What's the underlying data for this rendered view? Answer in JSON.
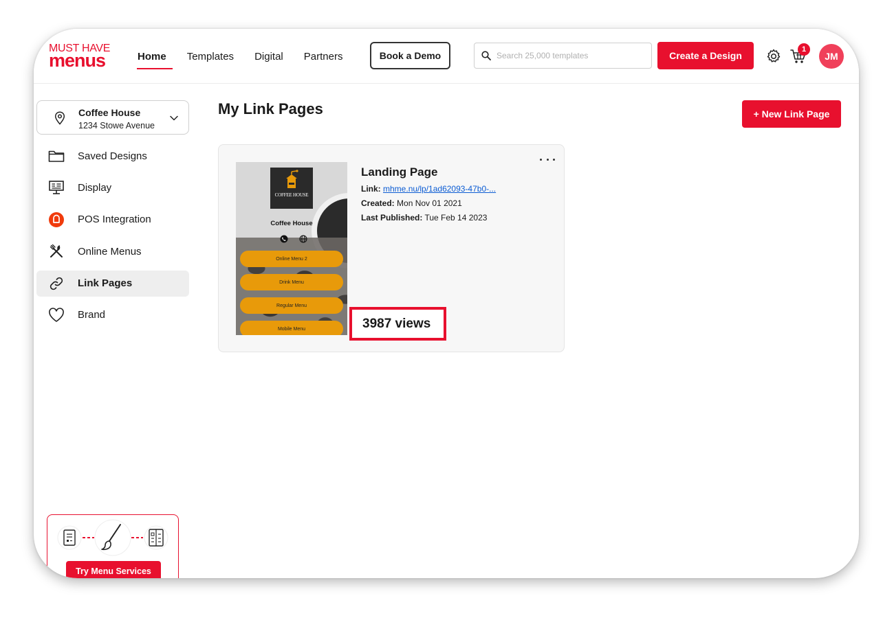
{
  "brand": {
    "logo_top": "MUST HAVE",
    "logo_bottom": "menus",
    "accent": "#e8102e"
  },
  "header": {
    "nav": [
      "Home",
      "Templates",
      "Digital",
      "Partners"
    ],
    "book_demo": "Book a Demo",
    "search_placeholder": "Search 25,000 templates",
    "create_label": "Create a Design",
    "cart_count": "1",
    "avatar_initials": "JM",
    "icons": [
      "search-icon",
      "gear-icon",
      "cart-icon"
    ]
  },
  "sidebar": {
    "location": {
      "name": "Coffee House",
      "address": "1234 Stowe Avenue"
    },
    "items": [
      {
        "label": "Saved Designs",
        "icon": "folder-icon"
      },
      {
        "label": "Display",
        "icon": "display-icon"
      },
      {
        "label": "POS Integration",
        "icon": "pos-icon"
      },
      {
        "label": "Online Menus",
        "icon": "utensils-icon"
      },
      {
        "label": "Link Pages",
        "icon": "link-icon"
      },
      {
        "label": "Brand",
        "icon": "heart-icon"
      }
    ],
    "active_item": "Link Pages",
    "promo_button": "Try Menu Services"
  },
  "main": {
    "title": "My Link Pages",
    "new_button": "+ New Link Page",
    "card": {
      "title": "Landing Page",
      "link_label": "Link:",
      "link_value": "mhme.nu/lp/1ad62093-47b0-...",
      "created_label": "Created:",
      "created_value": "Mon Nov 01 2021",
      "published_label": "Last Published:",
      "published_value": "Tue Feb 14 2023",
      "views": "3987 views",
      "thumbnail": {
        "logo_text": "COFFEE HOUSE",
        "name": "Coffee House",
        "buttons": [
          "Online Menu 2",
          "Drink Menu",
          "Regular Menu",
          "Mobile Menu"
        ],
        "button_color": "#e89a0a"
      }
    }
  }
}
